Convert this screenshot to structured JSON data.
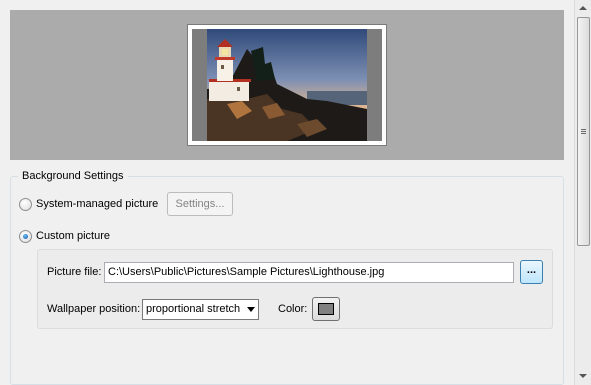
{
  "preview": {
    "image_name": "lighthouse-wallpaper-thumbnail"
  },
  "background_settings": {
    "group_title": "Background Settings",
    "system_managed": {
      "label": "System-managed picture",
      "selected": false
    },
    "settings_button": {
      "label": "Settings...",
      "enabled": false
    },
    "custom_picture": {
      "label": "Custom picture",
      "selected": true
    },
    "picture_file": {
      "label": "Picture file:",
      "value": "C:\\Users\\Public\\Pictures\\Sample Pictures\\Lighthouse.jpg"
    },
    "browse_button": {
      "label": "..."
    },
    "wallpaper_position": {
      "label": "Wallpaper position:",
      "selected": "proportional stretch"
    },
    "color": {
      "label": "Color:",
      "value": "#808080"
    }
  },
  "colors": {
    "preview_bg": "#ababab",
    "radio_selected": "#1f63b5",
    "focus_border": "#3c7fb1"
  }
}
